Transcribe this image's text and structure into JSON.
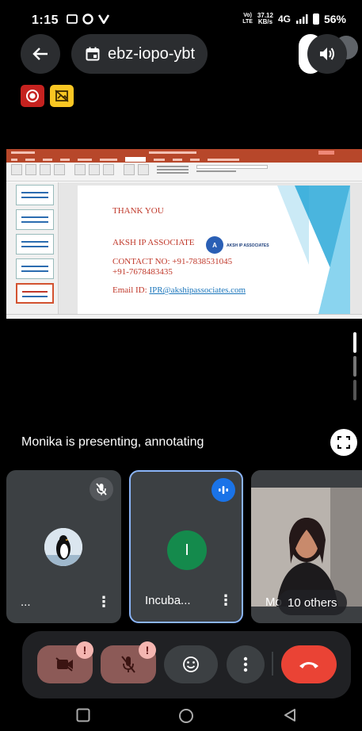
{
  "status_bar": {
    "time": "1:15",
    "network_label_top": "Vo)",
    "network_label_bottom": "LTE",
    "speed_value": "37.12",
    "speed_unit": "KB/s",
    "network_type": "4G",
    "battery": "56%"
  },
  "header": {
    "meeting_code": "ebz-iopo-ybt"
  },
  "slide": {
    "title": "THANK YOU",
    "company": "AKSH IP ASSOCIATE",
    "logo_text": "AKSH IP ASSOCIATES",
    "contact_line1": "CONTACT NO: +91-7838531045",
    "contact_line2": "+91-7678483435",
    "email_label": "Email ID:",
    "email": "IPR@akshipassociates.com"
  },
  "presentation": {
    "status_text": "Monika is presenting, annotating"
  },
  "participants": {
    "tile1_name": "...",
    "tile2_name": "Incuba...",
    "tile2_initial": "I",
    "tile3_name": "Mo",
    "others": "10 others"
  },
  "colors": {
    "end_call": "#ea4335",
    "muted_bg": "#8c5a57",
    "tile_bg": "#3c4043",
    "active_border": "#8ab4f8"
  }
}
